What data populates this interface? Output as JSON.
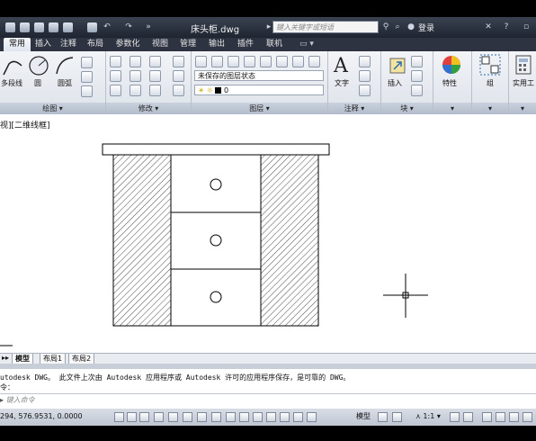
{
  "title_bar": {
    "document_title": "床头柜.dwg",
    "search_placeholder": "键入关键字或短语",
    "login_label": "登录"
  },
  "tabs": [
    "常用",
    "插入",
    "注释",
    "布局",
    "参数化",
    "视图",
    "管理",
    "输出",
    "插件",
    "联机"
  ],
  "active_tab": "常用",
  "ribbon": {
    "draw": {
      "polyline_label": "多段线",
      "circle_label": "圆",
      "arc_label": "圆弧",
      "panel_title": "绘图 ▾"
    },
    "modify": {
      "panel_title": "修改 ▾"
    },
    "layers": {
      "layer_state": "未保存的图层状态",
      "current_layer": "0",
      "panel_title": "图层 ▾"
    },
    "annotation": {
      "text_label": "文字",
      "panel_title": "注释 ▾"
    },
    "block": {
      "insert_label": "插入",
      "panel_title": "块 ▾"
    },
    "properties": {
      "label": "特性"
    },
    "groups": {
      "label": "组"
    },
    "utilities": {
      "label": "实用工"
    }
  },
  "viewport": {
    "label": "视][二维线框]"
  },
  "layout_tabs": [
    "模型",
    "布局1",
    "布局2"
  ],
  "command": {
    "history_line": "utodesk DWG。  此文件上次由 Autodesk 应用程序或 Autodesk 许可的应用程序保存，是可靠的 DWG。",
    "prompt_line": "令：",
    "input_placeholder": "键入命令"
  },
  "status_bar": {
    "coordinates": "294, 576.9531, 0.0000",
    "model_label": "模型",
    "annotation_scale": "1:1"
  },
  "colors": {
    "titlebar": "#2a303c",
    "ribbon": "#e4e8ee",
    "canvas": "#ffffff",
    "drawing_lines": "#000000"
  }
}
